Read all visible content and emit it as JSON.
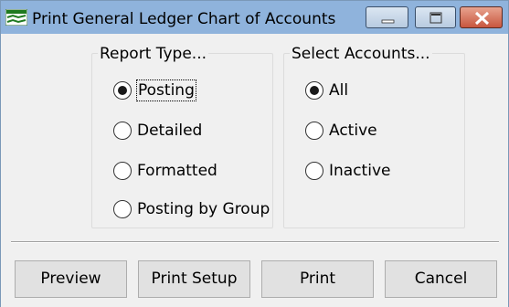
{
  "window": {
    "title": "Print General Ledger Chart of Accounts",
    "app_icon": "ledger-app-icon"
  },
  "report_type": {
    "label": "Report Type...",
    "options": [
      {
        "label": "Posting",
        "selected": true,
        "focused": true
      },
      {
        "label": "Detailed",
        "selected": false
      },
      {
        "label": "Formatted",
        "selected": false
      },
      {
        "label": "Posting by Group",
        "selected": false
      }
    ]
  },
  "select_accounts": {
    "label": "Select Accounts...",
    "options": [
      {
        "label": "All",
        "selected": true
      },
      {
        "label": "Active",
        "selected": false
      },
      {
        "label": "Inactive",
        "selected": false
      }
    ]
  },
  "buttons": {
    "preview": "Preview",
    "print_setup": "Print Setup",
    "print": "Print",
    "cancel": "Cancel"
  },
  "colors": {
    "titlebar": "#8fb3dc",
    "close_button": "#c8563e",
    "dialog_background": "#f0f0f0"
  }
}
